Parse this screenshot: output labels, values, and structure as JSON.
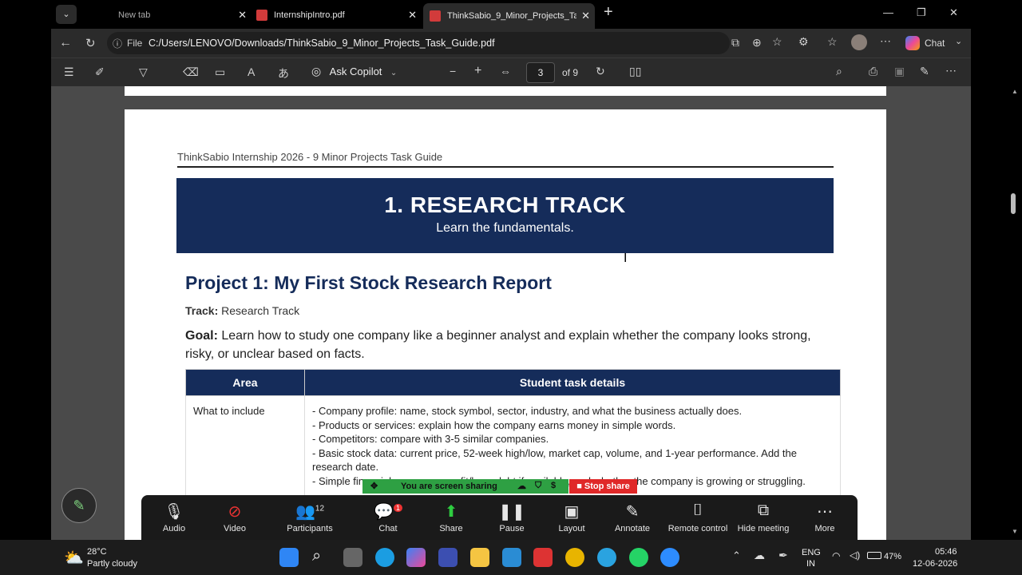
{
  "tabs": [
    {
      "label": "New tab"
    },
    {
      "label": "InternshipIntro.pdf"
    },
    {
      "label": "ThinkSabio_9_Minor_Projects_Task_Guide.pdf"
    }
  ],
  "address": {
    "scheme": "File",
    "url": "C:/Users/LENOVO/Downloads/ThinkSabio_9_Minor_Projects_Task_Guide.pdf"
  },
  "browser": {
    "chat_label": "Chat"
  },
  "pdf_toolbar": {
    "copilot": "Ask Copilot",
    "page": "3",
    "of": "of 9"
  },
  "doc": {
    "header": "ThinkSabio Internship 2026 - 9 Minor Projects Task Guide",
    "banner_title": "1. RESEARCH TRACK",
    "banner_sub": "Learn the fundamentals.",
    "project_title": "Project 1: My First Stock Research Report",
    "track_label": "Track:",
    "track_value": "Research Track",
    "goal_label": "Goal:",
    "goal_text": "Learn how to study one company like a beginner analyst and explain whether the company looks strong, risky, or unclear based on facts.",
    "table": {
      "headers": [
        "Area",
        "Student task details"
      ],
      "row_area": "What to include",
      "row_lines": [
        "- Company profile: name, stock symbol, sector, industry, and what the business actually does.",
        "- Products or services: explain how the company earns money in simple words.",
        "- Competitors: compare with 3-5 similar companies.",
        "- Basic stock data: current price, 52-week high/low, market cap, volume, and 1-year performance. Add the research date.",
        "- Simple financials: revenue, profit/loss, debt if available, and whether the company is growing or struggling."
      ]
    }
  },
  "zoom": {
    "participants_count": "12",
    "chat_badge": "1",
    "items": [
      "Audio",
      "Video",
      "Participants",
      "Chat",
      "Share",
      "Pause",
      "Layout",
      "Annotate",
      "Remote control",
      "Hide meeting",
      "More"
    ],
    "sharing_text": "You are screen sharing",
    "stop_share": "Stop share"
  },
  "taskbar": {
    "temp": "28°C",
    "weather": "Partly cloudy",
    "lang1": "ENG",
    "lang2": "IN",
    "battery": "47%",
    "time": "05:46",
    "date": "12-06-2026"
  }
}
